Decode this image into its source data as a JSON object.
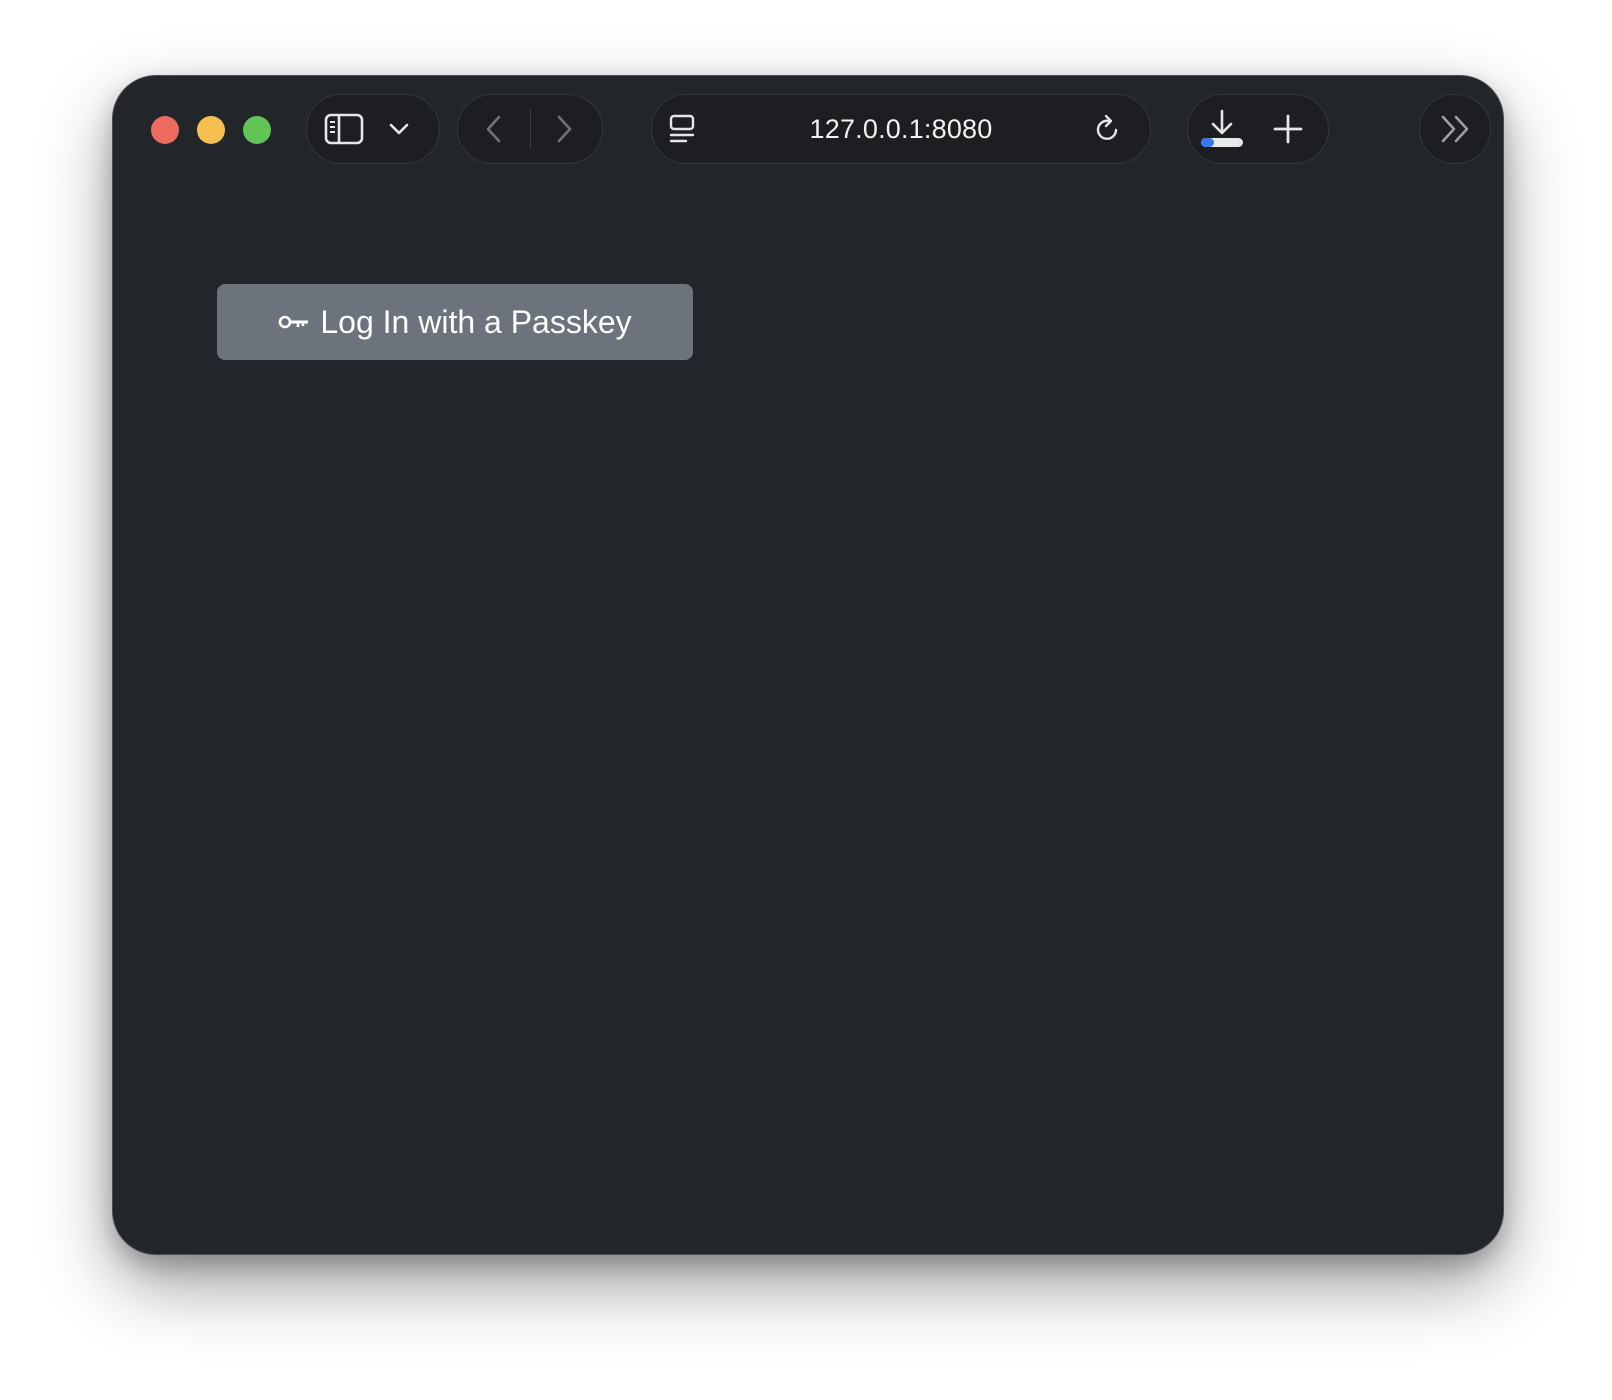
{
  "browser": {
    "address": "127.0.0.1:8080",
    "icons": {
      "sidebar": "sidebar-icon",
      "sidebar_menu": "chevron-down-icon",
      "back": "chevron-left-icon",
      "forward": "chevron-right-icon",
      "page_menu": "page-menu-icon",
      "reload": "reload-icon",
      "downloads": "download-icon",
      "new_tab": "plus-icon",
      "overflow": "double-chevron-right-icon"
    },
    "colors": {
      "close": "#ed6a5e",
      "minimize": "#f5c04f",
      "zoom": "#61c454",
      "download_progress": "#3478f6"
    }
  },
  "page": {
    "login_button": {
      "label": "Log In with a Passkey",
      "icon": "key-icon",
      "color": "#6c737c"
    }
  }
}
